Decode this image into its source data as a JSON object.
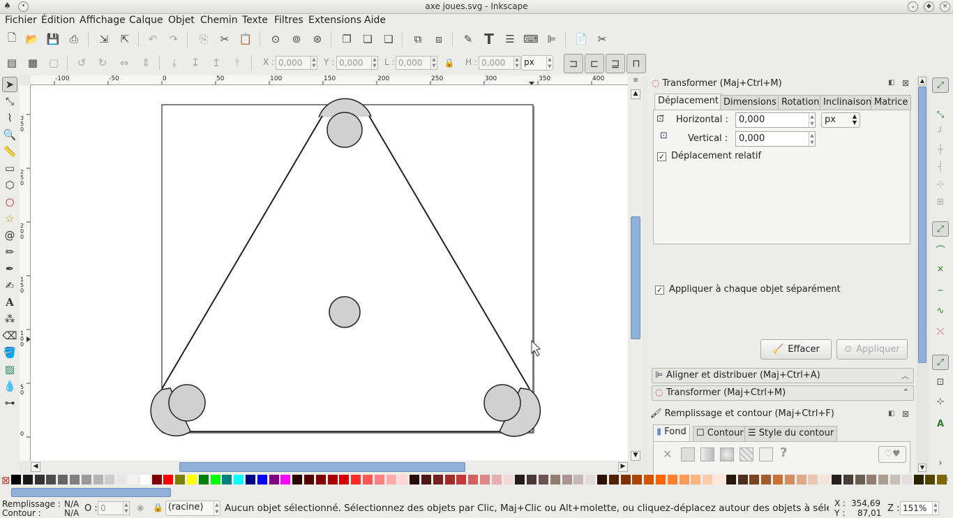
{
  "window": {
    "title": "axe joues.svg - Inkscape"
  },
  "menu": [
    "Fichier",
    "Édition",
    "Affichage",
    "Calque",
    "Objet",
    "Chemin",
    "Texte",
    "Filtres",
    "Extensions",
    "Aide"
  ],
  "toolcontrols": {
    "x_label": "X :",
    "x_value": "0,000",
    "y_label": "Y :",
    "y_value": "0,000",
    "w_label": "L :",
    "w_value": "0,000",
    "h_label": "H :",
    "h_value": "0,000",
    "unit": "px"
  },
  "rulers": {
    "horizontal_ticks": [
      "-100",
      "-50",
      "0",
      "50",
      "100",
      "150",
      "200",
      "250",
      "300",
      "350",
      "400"
    ],
    "vertical_ticks": [
      "350",
      "250",
      "200",
      "150",
      "100",
      "50",
      "0"
    ]
  },
  "transform_panel": {
    "title": "Transformer (Maj+Ctrl+M)",
    "tabs": [
      "Déplacement",
      "Dimensions",
      "Rotation",
      "Inclinaison",
      "Matrice"
    ],
    "horizontal_label": "Horizontal :",
    "horizontal_value": "0,000",
    "vertical_label": "Vertical :",
    "vertical_value": "0,000",
    "unit": "px",
    "relative_label": "Déplacement relatif",
    "relative_checked": "✓",
    "each_object_label": "Appliquer à chaque objet séparément",
    "each_object_checked": "✓",
    "clear_label": "Effacer",
    "apply_label": "Appliquer"
  },
  "collapsed_panels": [
    "Aligner et distribuer (Maj+Ctrl+A)",
    "Transformer (Maj+Ctrl+M)"
  ],
  "fill_panel": {
    "title": "Remplissage et contour (Maj+Ctrl+F)",
    "tabs": [
      "Fond",
      "Contour",
      "Style du contour"
    ],
    "unknown_glyph": "?"
  },
  "status": {
    "fill_label": "Remplissage :",
    "fill_value": "N/A",
    "stroke_label": "Contour :",
    "stroke_value": "N/A",
    "opacity_label": "O :",
    "opacity_value": "0",
    "layer": "(racine)",
    "message": "Aucun objet sélectionné. Sélectionnez des objets par Clic, Maj+Clic ou Alt+molette, ou cliquez-déplacez autour des objets à sélectionner.",
    "x_label": "X :",
    "x_value": "354,69",
    "y_label": "Y :",
    "y_value": "87,01",
    "zoom_label": "Z :",
    "zoom_value": "151%"
  },
  "palette": [
    "#000000",
    "#1a1a1a",
    "#333333",
    "#4d4d4d",
    "#666666",
    "#808080",
    "#999999",
    "#b3b3b3",
    "#cccccc",
    "#e6e6e6",
    "#f2f2f2",
    "#ffffff",
    "#800000",
    "#ff0000",
    "#808000",
    "#ffff00",
    "#008000",
    "#00ff00",
    "#008080",
    "#00ffff",
    "#000080",
    "#0000ff",
    "#800080",
    "#ff00ff",
    "#2b0000",
    "#550000",
    "#800000",
    "#aa0000",
    "#d40000",
    "#ff2a2a",
    "#ff5555",
    "#ff8080",
    "#ffaaaa",
    "#ffd5d5",
    "#280b0b",
    "#501616",
    "#782121",
    "#a02c2c",
    "#c83737",
    "#d35f5f",
    "#de8787",
    "#e9afaf",
    "#f4d7d7",
    "#241c1c",
    "#483737",
    "#6c5353",
    "#917c6f",
    "#ac9393",
    "#c8b7b7",
    "#e3dbdb",
    "#2b1100",
    "#552200",
    "#803300",
    "#aa4400",
    "#d45500",
    "#ff6600",
    "#ff7f2a",
    "#ff9955",
    "#ffb380",
    "#ffccaa",
    "#ffe6d5",
    "#28170b",
    "#502d16",
    "#784421",
    "#a05a2c",
    "#c87137",
    "#d38d5f",
    "#deaa87",
    "#e9c6af",
    "#f4e3d7",
    "#241f1c",
    "#483e37",
    "#6c5d53",
    "#917c6f",
    "#ac9d93",
    "#c8beb7",
    "#e3dedb",
    "#2b2200",
    "#554400",
    "#806600"
  ]
}
